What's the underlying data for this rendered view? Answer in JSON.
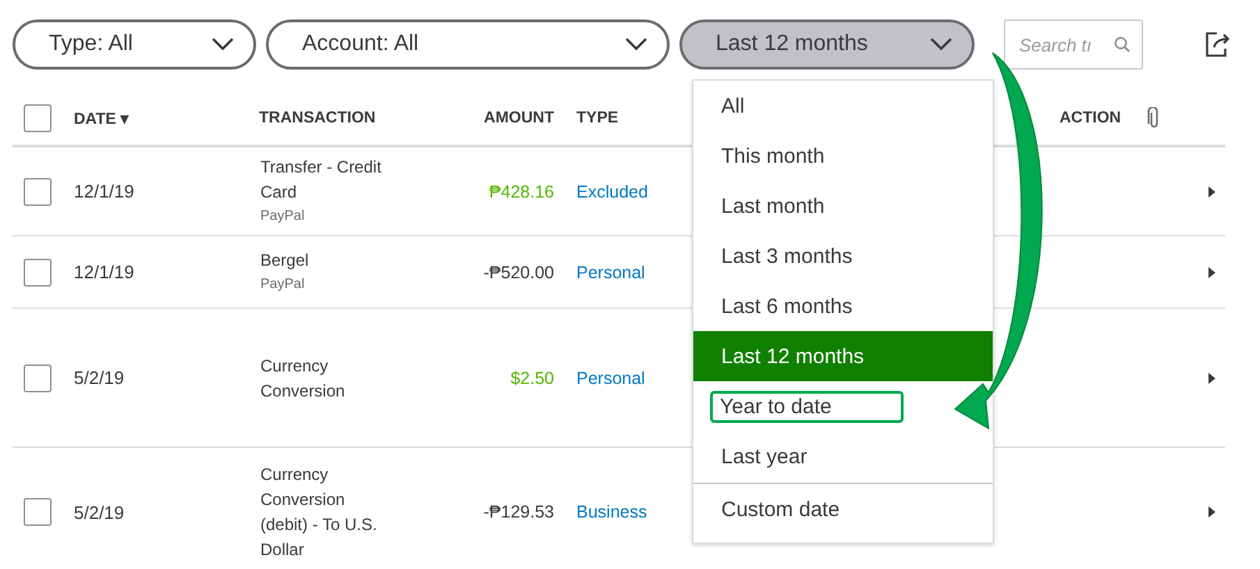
{
  "filters": [
    {
      "label": "Type: All",
      "active": false
    },
    {
      "label": "Account: All",
      "active": false
    },
    {
      "label": "Last 12 months",
      "active": true
    }
  ],
  "search": {
    "placeholder": "Search tı"
  },
  "table": {
    "select_all": {
      "checked": false
    },
    "columns": [
      "DATE ▾",
      "TRANSACTION",
      "AMOUNT",
      "TYPE",
      "ACTION"
    ],
    "rows": [
      {
        "checked": false,
        "date": "12/1/19",
        "transaction": [
          "Transfer - Credit",
          "Card"
        ],
        "source": "PayPal",
        "amount": "₱428.16",
        "positive": true,
        "type": "Excluded"
      },
      {
        "checked": false,
        "date": "12/1/19",
        "transaction": [
          "Bergel"
        ],
        "source": "PayPal",
        "amount": "-₱520.00",
        "positive": false,
        "type": "Personal"
      },
      {
        "checked": false,
        "date": "5/2/19",
        "transaction": [
          "Currency",
          "Conversion"
        ],
        "amount": "$2.50",
        "positive": true,
        "type": "Personal"
      },
      {
        "checked": false,
        "date": "5/2/19",
        "transaction": [
          "Currency",
          "Conversion",
          "(debit) - To U.S.",
          "Dollar"
        ],
        "amount": "-₱129.53",
        "positive": false,
        "type": "Business"
      }
    ]
  },
  "date_menu": {
    "items": [
      {
        "label": "All",
        "selected": false,
        "highlighted": false
      },
      {
        "label": "This month",
        "selected": false,
        "highlighted": false
      },
      {
        "label": "Last month",
        "selected": false,
        "highlighted": false
      },
      {
        "label": "Last 3 months",
        "selected": false,
        "highlighted": false
      },
      {
        "label": "Last 6 months",
        "selected": false,
        "highlighted": false
      },
      {
        "label": "Last 12 months",
        "selected": true,
        "highlighted": false
      },
      {
        "label": "Year to date",
        "selected": false,
        "highlighted": true
      },
      {
        "label": "Last year",
        "selected": false,
        "highlighted": false
      }
    ],
    "footer_items": [
      {
        "label": "Custom date",
        "selected": false,
        "highlighted": false
      }
    ]
  }
}
